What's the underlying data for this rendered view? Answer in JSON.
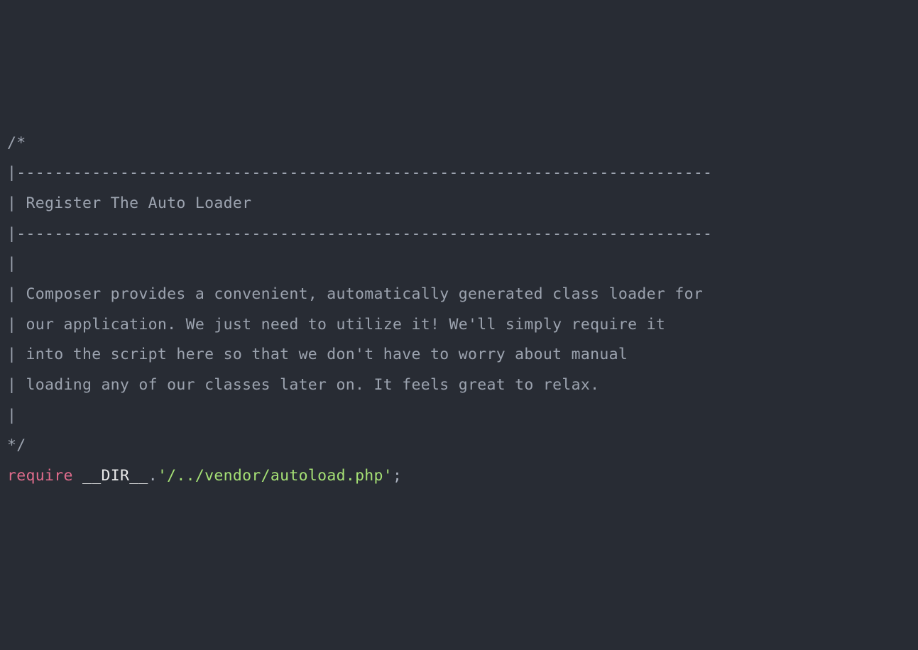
{
  "code": {
    "lines": [
      {
        "type": "comment",
        "text": "/*"
      },
      {
        "type": "comment",
        "text": "|--------------------------------------------------------------------------"
      },
      {
        "type": "comment",
        "text": "| Register The Auto Loader"
      },
      {
        "type": "comment",
        "text": "|--------------------------------------------------------------------------"
      },
      {
        "type": "comment",
        "text": "|"
      },
      {
        "type": "comment",
        "text": "| Composer provides a convenient, automatically generated class loader for"
      },
      {
        "type": "comment",
        "text": "| our application. We just need to utilize it! We'll simply require it"
      },
      {
        "type": "comment",
        "text": "| into the script here so that we don't have to worry about manual"
      },
      {
        "type": "comment",
        "text": "| loading any of our classes later on. It feels great to relax."
      },
      {
        "type": "comment",
        "text": "|"
      },
      {
        "type": "comment",
        "text": "*/"
      },
      {
        "type": "blank",
        "text": ""
      }
    ],
    "require_line": {
      "keyword": "require",
      "space1": " ",
      "magic_constant": "__DIR__",
      "dot": ".",
      "string": "'/../vendor/autoload.php'",
      "semicolon": ";"
    }
  }
}
